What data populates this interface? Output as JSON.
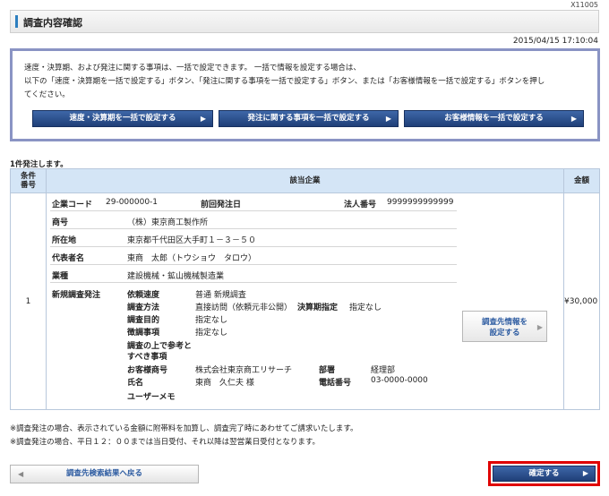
{
  "screen_id": "X11005",
  "page_title": "調査内容確認",
  "timestamp": "2015/04/15 17:10:04",
  "info": {
    "line1": "速度・決算期、および発注に関する事項は、一括で設定できます。 一括で情報を設定する場合は、",
    "line2": "以下の「速度・決算期を一括で設定する」ボタン、「発注に関する事項を一括で設定する」ボタン、または「お客様情報を一括で設定する」ボタンを押し",
    "line3": "てください。",
    "buttons": {
      "speed": "速度・決算期を一括で設定する",
      "order": "発注に関する事項を一括で設定する",
      "customer": "お客様情報を一括で設定する"
    }
  },
  "count_text": "1件発注します。",
  "table": {
    "headers": {
      "num_line1": "条件",
      "num_line2": "番号",
      "company": "該当企業",
      "amount": "金額"
    },
    "row": {
      "num": "1",
      "amount": "¥30,000",
      "company_code_label": "企業コード",
      "company_code": "29-000000-1",
      "prev_order_label": "前回発注日",
      "corp_no_label": "法人番号",
      "corp_no": "9999999999999",
      "name_label": "商号",
      "name": "（株）東京商工製作所",
      "address_label": "所在地",
      "address": "東京都千代田区大手町１－３－５０",
      "rep_label": "代表者名",
      "rep": "東商　太郎（トウショウ　タロウ）",
      "industry_label": "業種",
      "industry": "建設機械・鉱山機械製造業",
      "new_order_label": "新規調査発注",
      "speed_label": "依頼速度",
      "speed": "普通 新規調査",
      "method_label": "調査方法",
      "method": "直接訪問（依頼元非公開）",
      "fiscal_label": "決算期指定",
      "fiscal": "指定なし",
      "purpose_label": "調査目的",
      "purpose": "指定なし",
      "focus_label": "徴調事項",
      "focus": "指定なし",
      "ref_label_line1": "調査の上で参考と",
      "ref_label_line2": "すべき事項",
      "customer_label": "お客様商号",
      "customer": "株式会社東京商工リサーチ",
      "dept_label": "部署",
      "dept": "経理部",
      "person_label": "氏名",
      "person": "東商　久仁夫 様",
      "phone_label": "電話番号",
      "phone": "03-0000-0000",
      "memo_label": "ユーザーメモ",
      "set_info_btn_line1": "調査先情報を",
      "set_info_btn_line2": "設定する"
    }
  },
  "notes": {
    "line1": "※調査発注の場合、表示されている金額に附帯料を加算し、調査完了時にあわせてご請求いたします。",
    "line2": "※調査発注の場合、平日１２：００までは当日受付、それ以降は翌営業日受付となります。"
  },
  "buttons": {
    "back": "調査先検索結果へ戻る",
    "confirm": "確定する"
  }
}
